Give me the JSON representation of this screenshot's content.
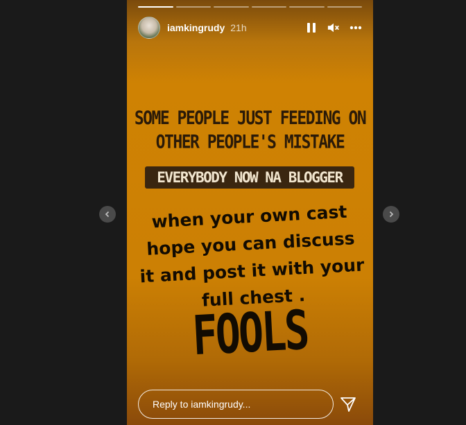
{
  "story": {
    "progress_segments": 6,
    "active_segment": 0,
    "user": {
      "username": "iamkingrudy",
      "time_ago": "21h"
    },
    "controls": [
      {
        "name": "pause-icon",
        "label": "Pause"
      },
      {
        "name": "mute-icon",
        "label": "Mute"
      },
      {
        "name": "more-options-icon",
        "label": "More options"
      }
    ],
    "content": {
      "headline_line1": "SOME PEOPLE JUST FEEDING ON",
      "headline_line2": "OTHER PEOPLE'S MISTAKE",
      "tag": "EVERYBODY NOW NA BLOGGER",
      "body_line1": "when your own cast",
      "body_line2": "hope you can discuss",
      "body_line3": "it and post it with your",
      "body_line4": "full chest .",
      "shout": "FOOLS"
    },
    "reply_placeholder": "Reply to iamkingrudy...",
    "send_icon": "send-icon"
  },
  "navigation": {
    "prev_icon": "chevron-left-icon",
    "next_icon": "chevron-right-icon"
  },
  "colors": {
    "story_bg": "#cc8004",
    "tag_bg": "#3a2610",
    "page_bg": "#1a1a1a"
  }
}
